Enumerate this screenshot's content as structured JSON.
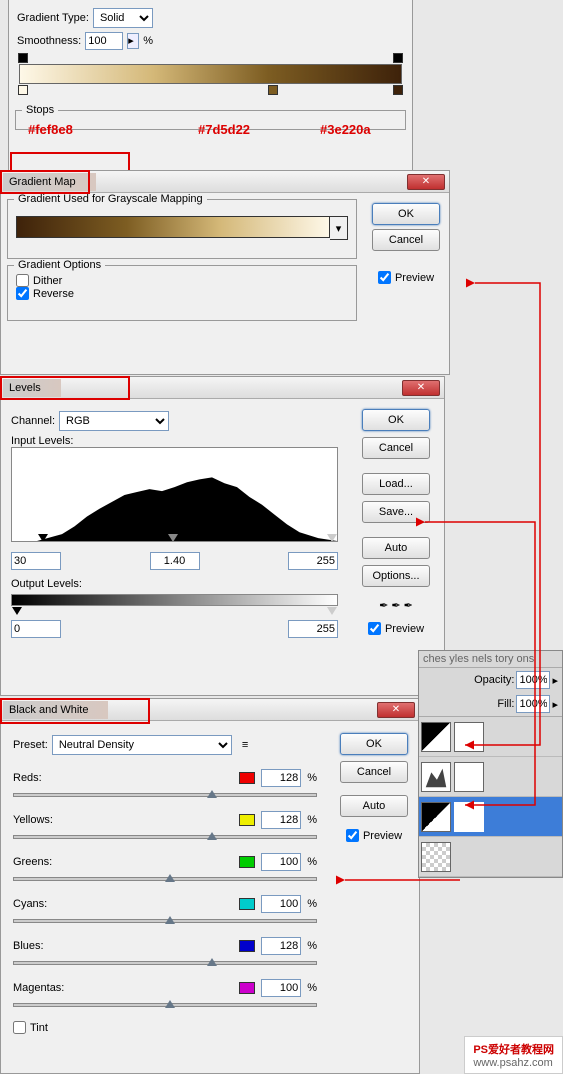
{
  "gradEditor": {
    "typeLabel": "Gradient Type:",
    "typeValue": "Solid",
    "smoothLabel": "Smoothness:",
    "smoothValue": "100",
    "pct": "%",
    "stopsLabel": "Stops",
    "colors": [
      "#fef8e8",
      "#7d5d22",
      "#3e220a"
    ]
  },
  "gradMap": {
    "title": "Gradient Map",
    "usedLabel": "Gradient Used for Grayscale Mapping",
    "optsLabel": "Gradient Options",
    "dither": "Dither",
    "reverse": "Reverse",
    "ok": "OK",
    "cancel": "Cancel",
    "preview": "Preview"
  },
  "levels": {
    "title": "Levels",
    "channelLabel": "Channel:",
    "channelValue": "RGB",
    "inputLabel": "Input Levels:",
    "outputLabel": "Output Levels:",
    "in": [
      "30",
      "1.40",
      "255"
    ],
    "out": [
      "0",
      "255"
    ],
    "ok": "OK",
    "cancel": "Cancel",
    "load": "Load...",
    "save": "Save...",
    "auto": "Auto",
    "options": "Options...",
    "preview": "Preview"
  },
  "bw": {
    "title": "Black and White",
    "presetLabel": "Preset:",
    "presetValue": "Neutral Density",
    "channels": [
      {
        "name": "Reds:",
        "val": "128",
        "color": "#e00"
      },
      {
        "name": "Yellows:",
        "val": "128",
        "color": "#ee0"
      },
      {
        "name": "Greens:",
        "val": "100",
        "color": "#0c0"
      },
      {
        "name": "Cyans:",
        "val": "100",
        "color": "#0cc"
      },
      {
        "name": "Blues:",
        "val": "128",
        "color": "#00c"
      },
      {
        "name": "Magentas:",
        "val": "100",
        "color": "#c0c"
      }
    ],
    "tint": "Tint",
    "ok": "OK",
    "cancel": "Cancel",
    "auto": "Auto",
    "preview": "Preview",
    "pct": "%"
  },
  "layers": {
    "opacity": "Opacity:",
    "opVal": "100%",
    "fill": "Fill:",
    "fillVal": "100%",
    "tabs": "ches  yles  nels  tory  ons"
  },
  "watermark": {
    "l1": "PS爱好者教程网",
    "l2": "www.psahz.com"
  }
}
